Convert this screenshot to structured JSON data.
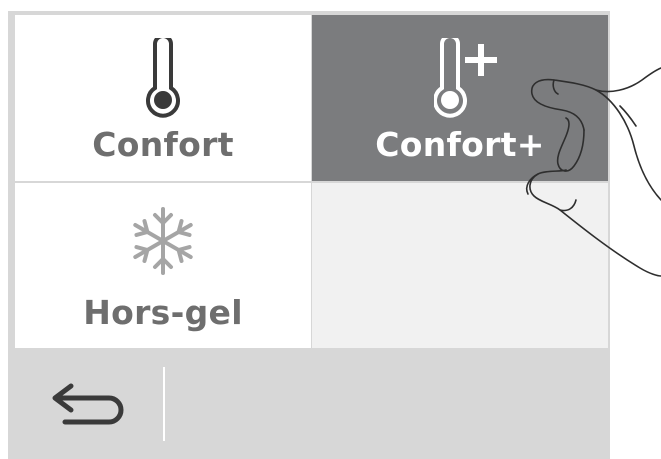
{
  "modes": {
    "confort": {
      "label": "Confort",
      "icon": "thermometer-icon"
    },
    "confort_plus": {
      "label": "Confort+",
      "icon": "thermometer-plus-icon",
      "selected": true
    },
    "hors_gel": {
      "label": "Hors-gel",
      "icon": "snowflake-icon"
    }
  },
  "bottom_bar": {
    "back_icon": "back-arrow-icon"
  },
  "colors": {
    "frame": "#d7d7d7",
    "tile": "#ffffff",
    "tile_selected": "#7b7c7e",
    "tile_empty": "#f1f1f1",
    "text": "#6e6e6e",
    "icon": "#3a3a3a",
    "snowflake": "#a5a5a5"
  }
}
